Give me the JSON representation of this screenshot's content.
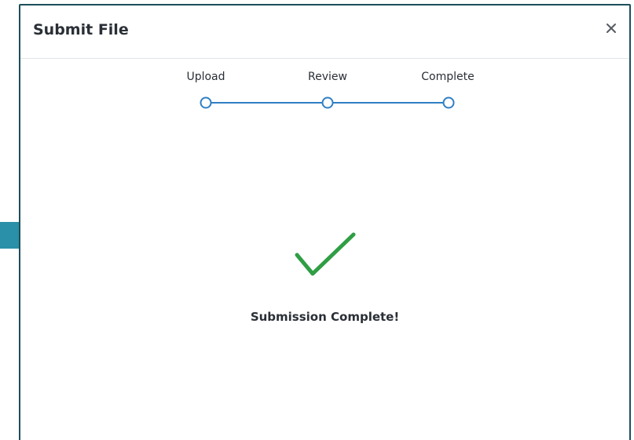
{
  "modal": {
    "title": "Submit File",
    "close_symbol": "×"
  },
  "stepper": {
    "steps": [
      {
        "label": "Upload"
      },
      {
        "label": "Review"
      },
      {
        "label": "Complete"
      }
    ]
  },
  "result": {
    "icon": "check-icon",
    "message": "Submission Complete!"
  },
  "colors": {
    "arrow": "#2a8fa8",
    "modal_border": "#1c4f5a",
    "stepper_line": "#2f7fc4",
    "success_check": "#2f9e44"
  },
  "icons": {
    "pointer": "arrow-right-icon",
    "close": "close-icon",
    "success": "check-icon"
  }
}
